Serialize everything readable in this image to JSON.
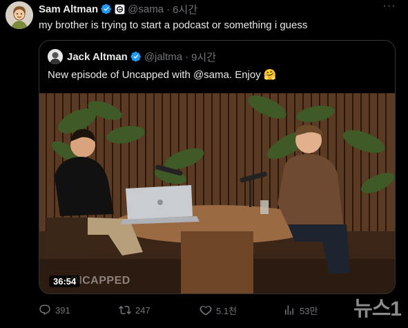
{
  "tweet": {
    "author_name": "Sam Altman",
    "author_handle": "@sama",
    "time": "6시간",
    "text": "my brother is trying to start a podcast or something i guess",
    "more_glyph": "···"
  },
  "quote": {
    "author_name": "Jack Altman",
    "author_handle": "@jaltma",
    "time": "9시간",
    "text": "New episode of Uncapped with @sama. Enjoy",
    "emoji": "🤗",
    "video_duration": "36:54",
    "video_overlay_text": "UNCAPPED"
  },
  "actions": {
    "reply_count": "391",
    "retweet_count": "247",
    "like_count": "5.1천",
    "views_count": "53만"
  },
  "watermark": {
    "text": "뉴스1"
  },
  "colors": {
    "verified": "#1d9bf0",
    "muted": "#71767b",
    "border": "#2f3336"
  },
  "icons": [
    "verified-badge-icon",
    "affiliate-badge-icon",
    "more-icon",
    "reply-icon",
    "retweet-icon",
    "like-icon",
    "views-icon"
  ]
}
